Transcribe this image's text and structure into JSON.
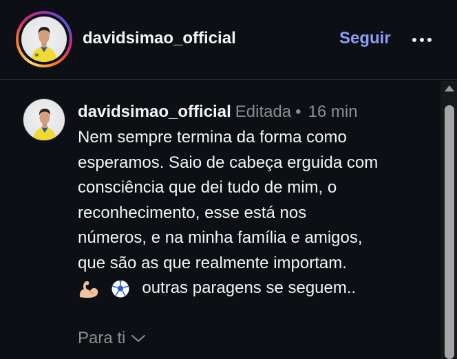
{
  "header": {
    "username": "davidsimao_official",
    "follow_label": "Seguir",
    "more_icon": "more-horizontal-icon"
  },
  "comment": {
    "username": "davidsimao_official",
    "edited": "Editada",
    "separator": "•",
    "time": "16 min",
    "lines": [
      "Nem sempre termina da forma como",
      "esperamos. Saio de cabeça erguida com",
      "consciência que dei tudo de mim, o",
      "reconhecimento, esse está nos",
      "números, e na minha família e amigos,",
      "que são as que realmente importam."
    ],
    "emojis": [
      "flexed-biceps-emoji",
      "soccer-ball-emoji"
    ],
    "last_line_text": "outras paragens se seguem..",
    "translate_label": "Para ti"
  },
  "colors": {
    "background": "#0c0f14",
    "accent": "#8c9ef7",
    "muted": "#8e8e8e"
  }
}
